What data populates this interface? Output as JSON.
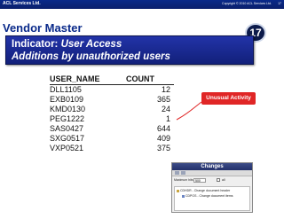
{
  "header": {
    "company": "ACL Services Ltd.",
    "copyright": "Copyright © 2010 ACL Services Ltd.",
    "slide_number": "17"
  },
  "title": "Vendor Master",
  "badge": "17",
  "indicator": {
    "label": "Indicator:",
    "value": "User Access",
    "subtitle": "Additions by unauthorized users"
  },
  "report": {
    "columns": [
      "USER_NAME",
      "COUNT"
    ],
    "rows": [
      {
        "user": "DLL1105",
        "count": "12"
      },
      {
        "user": "EXB0109",
        "count": "365"
      },
      {
        "user": "KMD0130",
        "count": "24"
      },
      {
        "user": "PEG1222",
        "count": "1"
      },
      {
        "user": "SAS0427",
        "count": "644"
      },
      {
        "user": "SXG0517",
        "count": "409"
      },
      {
        "user": "VXP0521",
        "count": "375"
      }
    ]
  },
  "callout": "Unusual Activity",
  "changes_window": {
    "title": "Changes",
    "max_hits_label": "Maximum hits",
    "max_hits_value": "500",
    "all_label": "all",
    "tree": [
      "CDHDR - Change document header",
      "CDPOS - Change document items"
    ]
  },
  "colors": {
    "brand_blue": "#0a2a8a",
    "indicator_blue": "#2233a8",
    "callout_red": "#e02626"
  }
}
